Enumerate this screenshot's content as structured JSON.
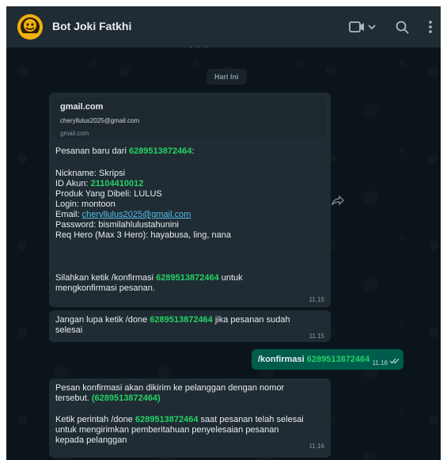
{
  "header": {
    "title": "Bot Joki Fatkhi",
    "icons": [
      "video-call-icon",
      "chevron-down-icon",
      "search-icon",
      "menu-icon"
    ]
  },
  "chat": {
    "prev_peek": "· · ·",
    "date_chip": "Hari Ini",
    "msg1": {
      "preview_title": "gmail.com",
      "preview_desc": "cheryllulus2025@gmail.com",
      "preview_url": "gmail.com",
      "line_order_prefix": "Pesanan baru dari ",
      "line_order_number": "6289513872464",
      "line_order_suffix": ":",
      "nickname": "Nickname: Skripsi",
      "id_prefix": "ID Akun: ",
      "id_value": "21104410012",
      "produk": "Produk Yang Dibeli: LULUS",
      "login": "Login: montoon",
      "email_prefix": "Email: ",
      "email_value": "cheryllulus2025@gmail.com",
      "password": "Password: bismilahlulustahunini",
      "req_hero": "Req Hero (Max 3 Hero): hayabusa, ling, nana",
      "confirm_prefix": "Silahkan ketik /konfirmasi ",
      "confirm_number": "6289513872464",
      "confirm_suffix": " untuk",
      "confirm_line2": "mengkonfirmasi pesanan.",
      "time": "11.15"
    },
    "msg2": {
      "prefix": "Jangan lupa ketik /done ",
      "number": "6289513872464",
      "suffix": " jika pesanan sudah",
      "line2": "selesai",
      "time": "11.15"
    },
    "msg3": {
      "prefix": "/konfirmasi ",
      "number": "6289513872464",
      "time": "11.16"
    },
    "msg4": {
      "line1": "Pesan konfirmasi akan dikirim ke pelanggan dengan nomor",
      "line2_prefix": "tersebut. ",
      "line2_number": "(6289513872464)",
      "line3_prefix": "Ketik perintah /done ",
      "line3_number": "6289513872464",
      "line3_suffix": " saat pesanan telah selesai",
      "line4": "untuk mengirimkan pemberitahuan penyelesaian pesanan",
      "line5": "kepada pelanggan",
      "time": "11.16"
    }
  },
  "colors": {
    "header_bg": "#202c33",
    "chat_bg": "#0b141a",
    "incoming_bubble": "#202c33",
    "outgoing_bubble": "#005c4b",
    "number_highlight": "#25d366",
    "link": "#53bdeb"
  }
}
